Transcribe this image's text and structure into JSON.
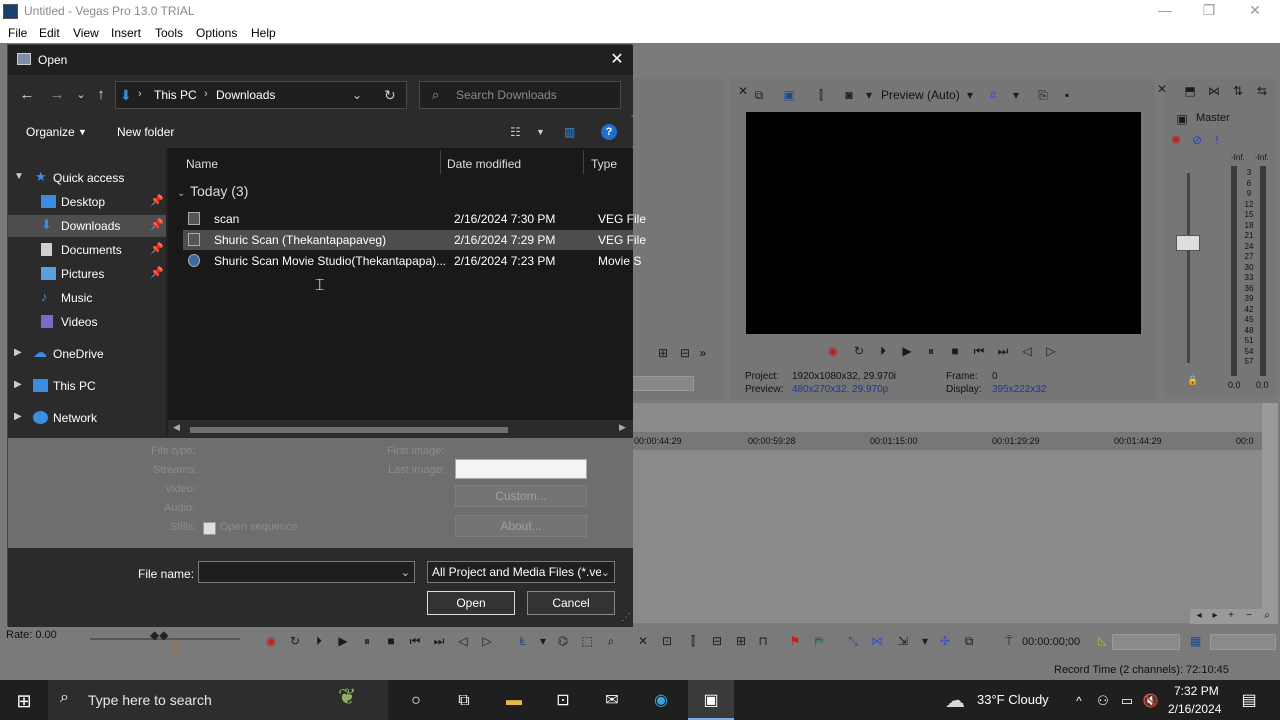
{
  "app": {
    "title": "Untitled - Vegas Pro 13.0 TRIAL",
    "menu": [
      "File",
      "Edit",
      "View",
      "Insert",
      "Tools",
      "Options",
      "Help"
    ],
    "window_controls": {
      "minimize": "—",
      "restore": "❐",
      "close": "✕"
    }
  },
  "preview": {
    "mode": "Preview (Auto)",
    "project_label": "Project:",
    "project_value": "1920x1080x32, 29.970i",
    "preview_label": "Preview:",
    "preview_value": "480x270x32, 29.970p",
    "frame_label": "Frame:",
    "frame_value": "0",
    "display_label": "Display:",
    "display_value": "395x222x32"
  },
  "master": {
    "title": "Master",
    "inf_left": "-Inf.",
    "inf_right": "-Inf.",
    "meter_ticks": [
      "3",
      "6",
      "9",
      "12",
      "15",
      "18",
      "21",
      "24",
      "27",
      "30",
      "33",
      "36",
      "39",
      "42",
      "45",
      "48",
      "51",
      "54",
      "57"
    ],
    "bottom_left": "0.0",
    "bottom_right": "0.0"
  },
  "timeline": {
    "ruler_labels": [
      "00:00:44:29",
      "00:00:59:28",
      "00:01:15:00",
      "00:01:29:29",
      "00:01:44:29",
      "00:0"
    ],
    "rate": "Rate: 0.00",
    "timecode": "00:00:00;00",
    "record_time": "Record Time (2 channels): 72:10:45"
  },
  "dialog": {
    "title": "Open",
    "close": "✕",
    "breadcrumb": [
      "This PC",
      "Downloads"
    ],
    "search_placeholder": "Search Downloads",
    "organize": "Organize",
    "new_folder": "New folder",
    "help": "?",
    "nav_items": [
      {
        "label": "Quick access",
        "pinned": false
      },
      {
        "label": "Desktop",
        "pinned": true
      },
      {
        "label": "Downloads",
        "pinned": true
      },
      {
        "label": "Documents",
        "pinned": true
      },
      {
        "label": "Pictures",
        "pinned": true
      },
      {
        "label": "Music",
        "pinned": false
      },
      {
        "label": "Videos",
        "pinned": false
      },
      {
        "label": "OneDrive",
        "pinned": false
      },
      {
        "label": "This PC",
        "pinned": false
      },
      {
        "label": "Network",
        "pinned": false
      }
    ],
    "columns": {
      "name": "Name",
      "date": "Date modified",
      "type": "Type"
    },
    "group": "Today (3)",
    "files": [
      {
        "name": "scan",
        "date": "2/16/2024 7:30 PM",
        "type": "VEG File"
      },
      {
        "name": "Shuric Scan (Thekantapapaveg)",
        "date": "2/16/2024 7:29 PM",
        "type": "VEG File"
      },
      {
        "name": "Shuric Scan Movie Studio(Thekantapapa)...",
        "date": "2/16/2024 7:23 PM",
        "type": "Movie S"
      }
    ],
    "props": {
      "file_type": "File type:",
      "streams": "Streams:",
      "video": "Video:",
      "audio": "Audio:",
      "stills": "Stills:",
      "open_sequence": "Open sequence",
      "first_image": "First image:",
      "last_image": "Last image:",
      "custom": "Custom...",
      "about": "About..."
    },
    "file_name_label": "File name:",
    "file_name_value": "",
    "filter": "All Project and Media Files (*.ve",
    "open_button": "Open",
    "cancel_button": "Cancel"
  },
  "taskbar": {
    "search_placeholder": "Type here to search",
    "weather": "33°F  Cloudy",
    "time": "7:32 PM",
    "date": "2/16/2024"
  },
  "colors": {
    "accent": "#0078d7",
    "folder": "#e8b84a"
  }
}
